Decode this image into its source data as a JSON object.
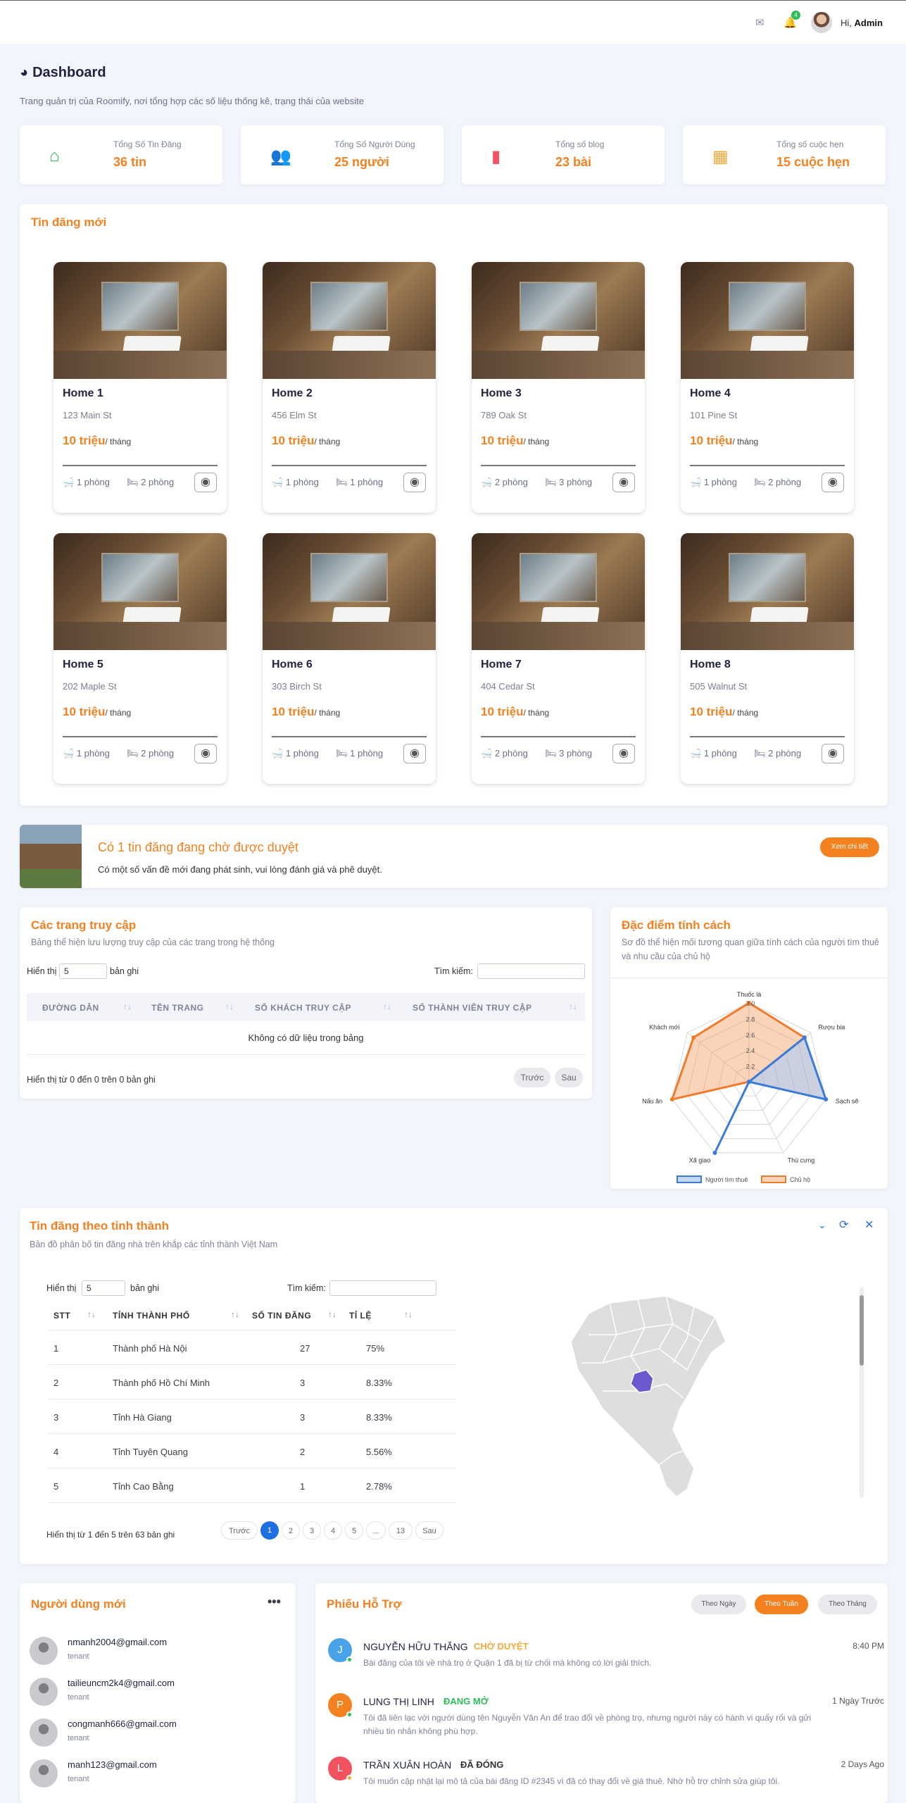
{
  "header": {
    "greeting": "Hi,",
    "user": "Admin",
    "notif_count": "4"
  },
  "page": {
    "title": "Dashboard",
    "subtitle": "Trang quản trị của Roomify, nơi tổng hợp các số liệu thống kê, trạng thái của website"
  },
  "stats": [
    {
      "label": "Tổng Số Tin Đăng",
      "value": "36 tin",
      "icon": "home-icon",
      "color": "#2ebd59"
    },
    {
      "label": "Tổng Số Người Dùng",
      "value": "25 người",
      "icon": "users-icon",
      "color": "#3b6bd8"
    },
    {
      "label": "Tổng số blog",
      "value": "23 bài",
      "icon": "blogger-icon",
      "color": "#f0525f"
    },
    {
      "label": "Tổng số cuộc hẹn",
      "value": "15 cuộc hẹn",
      "icon": "calendar-icon",
      "color": "#f4a93b"
    }
  ],
  "new_posts": {
    "title": "Tin đăng mới",
    "items": [
      {
        "name": "Home 1",
        "address": "123 Main St",
        "price": "10 triệu",
        "unit": "/ tháng",
        "baths": "1 phòng",
        "beds": "2 phòng"
      },
      {
        "name": "Home 2",
        "address": "456 Elm St",
        "price": "10 triệu",
        "unit": "/ tháng",
        "baths": "1 phòng",
        "beds": "1 phòng"
      },
      {
        "name": "Home 3",
        "address": "789 Oak St",
        "price": "10 triệu",
        "unit": "/ tháng",
        "baths": "2 phòng",
        "beds": "3 phòng"
      },
      {
        "name": "Home 4",
        "address": "101 Pine St",
        "price": "10 triệu",
        "unit": "/ tháng",
        "baths": "1 phòng",
        "beds": "2 phòng"
      },
      {
        "name": "Home 5",
        "address": "202 Maple St",
        "price": "10 triệu",
        "unit": "/ tháng",
        "baths": "1 phòng",
        "beds": "2 phòng"
      },
      {
        "name": "Home 6",
        "address": "303 Birch St",
        "price": "10 triệu",
        "unit": "/ tháng",
        "baths": "1 phòng",
        "beds": "1 phòng"
      },
      {
        "name": "Home 7",
        "address": "404 Cedar St",
        "price": "10 triệu",
        "unit": "/ tháng",
        "baths": "2 phòng",
        "beds": "3 phòng"
      },
      {
        "name": "Home 8",
        "address": "505 Walnut St",
        "price": "10 triệu",
        "unit": "/ tháng",
        "baths": "1 phòng",
        "beds": "2 phòng"
      }
    ]
  },
  "pending": {
    "title": "Có 1 tin đăng đang chờ được duyệt",
    "text": "Có một số vấn đề mới đang phát sinh, vui lòng đánh giá và phê duyệt.",
    "button": "Xem chi tiết"
  },
  "access": {
    "title": "Các trang truy cập",
    "subtitle": "Bảng thể hiện lưu lượng truy cập của các trang trong hệ thống",
    "show": "Hiển thị",
    "show_value": "5",
    "records": "bản ghi",
    "search": "Tìm kiếm:",
    "columns": [
      "ĐƯỜNG DẪN",
      "TÊN TRANG",
      "SỐ KHÁCH TRUY CẬP",
      "SỐ THÀNH VIÊN TRUY CẬP"
    ],
    "empty": "Không có dữ liệu trong bảng",
    "info": "Hiển thị từ 0 đến 0 trên 0 bản ghi",
    "prev": "Trước",
    "next": "Sau"
  },
  "personality": {
    "title": "Đặc điểm tính cách",
    "subtitle": "Sơ đồ thể hiện mối tương quan giữa tính cách của người tìm thuê và nhu cầu của chủ hộ"
  },
  "chart_data": {
    "type": "radar",
    "categories": [
      "Thuốc lá",
      "Rượu bia",
      "Sạch sẽ",
      "Thú cưng",
      "Xã giao",
      "Nấu ăn",
      "Khách mới"
    ],
    "ticks": [
      "2.2",
      "2.4",
      "2.6",
      "2.8",
      "3.0"
    ],
    "rlim": [
      2.0,
      3.0
    ],
    "series": [
      {
        "name": "Người tìm thuê",
        "color": "#3b7bd8",
        "values": [
          2.0,
          2.9,
          3.0,
          2.0,
          3.0,
          2.0,
          2.0
        ]
      },
      {
        "name": "Chủ hộ",
        "color": "#f07b2c",
        "values": [
          3.0,
          2.9,
          2.0,
          2.0,
          2.0,
          3.0,
          2.9
        ]
      }
    ]
  },
  "province": {
    "title": "Tin đăng theo tỉnh thành",
    "subtitle": "Bản đồ phân bố tin đăng nhà trên khắp các tỉnh thành Việt Nam",
    "show": "Hiển thị",
    "show_value": "5",
    "records": "bản ghi",
    "search": "Tìm kiếm:",
    "columns": [
      "STT",
      "TỈNH THÀNH PHỐ",
      "SỐ TIN ĐĂNG",
      "TỈ LỆ"
    ],
    "rows": [
      [
        "1",
        "Thành phố Hà Nội",
        "27",
        "75%"
      ],
      [
        "2",
        "Thành phố Hồ Chí Minh",
        "3",
        "8.33%"
      ],
      [
        "3",
        "Tỉnh Hà Giang",
        "3",
        "8.33%"
      ],
      [
        "4",
        "Tỉnh Tuyên Quang",
        "2",
        "5.56%"
      ],
      [
        "5",
        "Tỉnh Cao Bằng",
        "1",
        "2.78%"
      ]
    ],
    "info": "Hiển thị từ 1 đến 5 trên 63 bản ghi",
    "pages": [
      "Trước",
      "1",
      "2",
      "3",
      "4",
      "5",
      "...",
      "13",
      "Sau"
    ]
  },
  "new_users": {
    "title": "Người dùng mới",
    "items": [
      {
        "email": "nmanh2004@gmail.com",
        "role": "tenant"
      },
      {
        "email": "tailieuncm2k4@gmail.com",
        "role": "tenant"
      },
      {
        "email": "congmanh666@gmail.com",
        "role": "tenant"
      },
      {
        "email": "manh123@gmail.com",
        "role": "tenant"
      }
    ]
  },
  "support": {
    "title": "Phiếu Hỗ Trợ",
    "tabs": [
      "Theo Ngày",
      "Theo Tuần",
      "Theo Tháng"
    ],
    "tickets": [
      {
        "initial": "J",
        "name": "NGUYỄN HỮU THẮNG",
        "status": "CHỜ DUYỆT",
        "status_color": "#f4a93b",
        "time": "8:40 PM",
        "text": "Bài đăng của tôi về nhà trọ ở Quận 1 đã bị từ chối mà không có lời giải thích.",
        "color": "#4aa3e8",
        "dot": "#2ebd59"
      },
      {
        "initial": "P",
        "name": "LUNG THỊ LINH",
        "status": "ĐANG MỞ",
        "status_color": "#2ebd59",
        "time": "1 Ngày Trước",
        "text": "Tôi đã liên lạc với người dùng tên Nguyễn Văn An để trao đổi về phòng trọ, nhưng người này có hành vi quấy rối và gửi nhiều tin nhắn không phù hợp.",
        "color": "#f4811f",
        "dot": "#2ebd59"
      },
      {
        "initial": "L",
        "name": "TRẦN XUÂN HOÀN",
        "status": "ĐÃ ĐÓNG",
        "status_color": "#333",
        "time": "2 Days Ago",
        "text": "Tôi muốn cập nhật lại mô tả của bài đăng ID #2345 vì đã có thay đổi về giá thuê. Nhờ hỗ trợ chỉnh sửa giúp tôi.",
        "color": "#f0525f",
        "dot": "#f4a93b"
      }
    ]
  }
}
